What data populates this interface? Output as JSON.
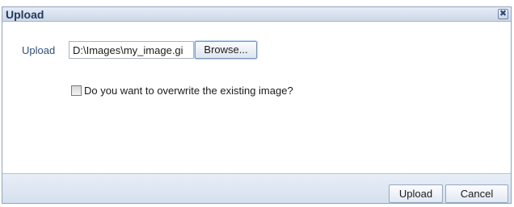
{
  "dialog": {
    "title": "Upload",
    "close_symbol": "✖"
  },
  "form": {
    "upload_label": "Upload",
    "file_path": "D:\\Images\\my_image.gi",
    "browse_label": "Browse...",
    "overwrite_checked": false,
    "overwrite_label": "Do you want to overwrite the existing image?"
  },
  "footer": {
    "upload_label": "Upload",
    "cancel_label": "Cancel"
  },
  "icons": {
    "close": "close-icon",
    "checkbox": "checkbox-icon"
  },
  "colors": {
    "title_text": "#233a5e",
    "label_text": "#2f4e7a",
    "dialog_border": "#8fa3bf",
    "titlebar_top": "#e7edf6",
    "titlebar_bottom": "#ccd7e7",
    "footer_top": "#e8eef7",
    "footer_bottom": "#d6e0ee",
    "browse_focus": "#b9d3f2"
  }
}
